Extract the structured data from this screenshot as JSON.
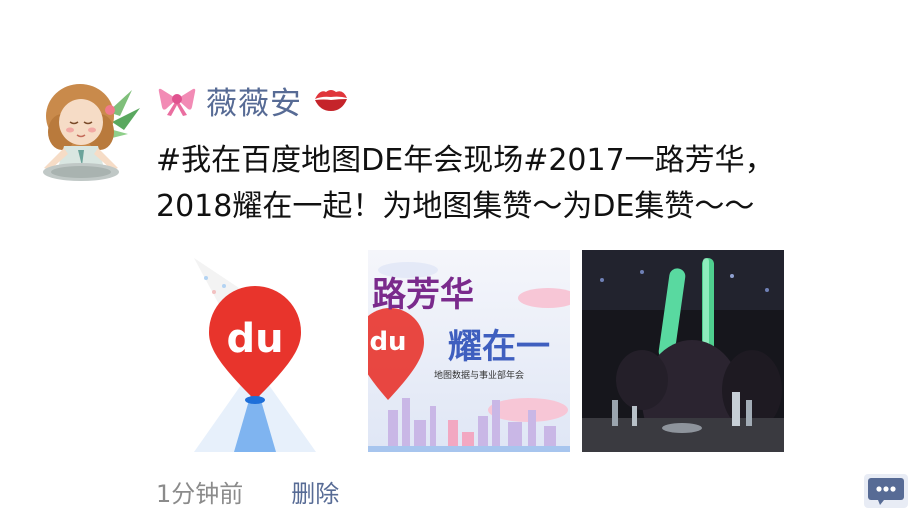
{
  "post": {
    "author": "薇薇安",
    "text_line1": "#我在百度地图DE年会现场#2017一路芳华，",
    "text_line2": "2018耀在一起！为地图集赞～为DE集赞～～",
    "images": [
      {
        "badge": "du"
      },
      {
        "badge": "du",
        "title_line1": "路芳华",
        "title_line2": "耀在一",
        "subtitle": "地图数据与事业部年会"
      },
      {}
    ]
  },
  "footer": {
    "time_ago": "1分钟前",
    "delete_label": "删除"
  },
  "icons": {
    "prefix_emoji": "ribbon-bow-icon",
    "suffix_emoji": "kiss-lips-icon",
    "comment": "comment-dots-icon"
  },
  "colors": {
    "link": "#576b95",
    "text": "#111111",
    "muted": "#8b8b8b",
    "baidu_red": "#e8342c"
  }
}
